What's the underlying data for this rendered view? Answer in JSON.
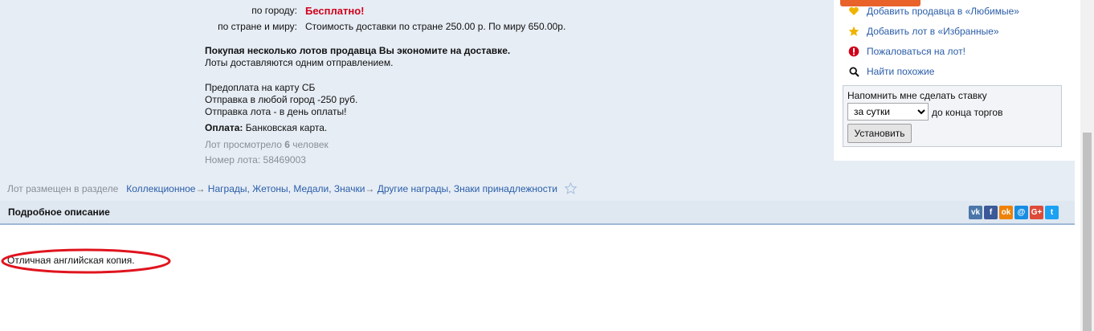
{
  "delivery": {
    "city_label": "по городу:",
    "city_value": "Бесплатно!",
    "country_label": "по стране и миру:",
    "country_value": "Стоимость доставки по стране 250.00 р. По миру 650.00р."
  },
  "promo": {
    "headline": "Покупая несколько лотов продавца Вы экономите на доставке.",
    "subline": "Лоты доставляются одним отправлением."
  },
  "notes": [
    "Предоплата на карту СБ",
    "Отправка в любой город -250 руб.",
    "Отправка лота - в день оплаты!"
  ],
  "payment": {
    "label": "Оплата:",
    "value": "Банковская карта."
  },
  "stats": {
    "views_prefix": "Лот просмотрело",
    "views_count": "6",
    "views_suffix": "человек",
    "lot_number": "Номер лота: 58469003"
  },
  "actions": {
    "add_seller": "Добавить продавца в «Любимые»",
    "add_lot": "Добавить лот в «Избранные»",
    "complain": "Пожаловаться на лот!",
    "find_similar": "Найти похожие"
  },
  "reminder": {
    "title": "Напомнить мне сделать ставку",
    "selected": "за сутки",
    "suffix": "до конца торгов",
    "button": "Установить"
  },
  "category": {
    "prefix": "Лот размещен в разделе",
    "path": [
      "Коллекционное",
      "Награды, Жетоны, Медали, Значки",
      "Другие награды, Знаки принадлежности"
    ],
    "arrow": "→"
  },
  "description": {
    "header": "Подробное описание",
    "text": "Отличная английская копия."
  },
  "share_icons": [
    {
      "name": "vk-icon",
      "glyph": "vk",
      "color": "#4a76a8"
    },
    {
      "name": "facebook-icon",
      "glyph": "f",
      "color": "#3b5998"
    },
    {
      "name": "odnoklassniki-icon",
      "glyph": "ok",
      "color": "#ee8208"
    },
    {
      "name": "moimir-icon",
      "glyph": "@",
      "color": "#168de2"
    },
    {
      "name": "googleplus-icon",
      "glyph": "G+",
      "color": "#dd4b39"
    },
    {
      "name": "twitter-icon",
      "glyph": "t",
      "color": "#1da1f2"
    }
  ],
  "colors": {
    "link": "#2a5da8",
    "accent_red": "#d0021b",
    "annotation_red": "#e0141e"
  }
}
